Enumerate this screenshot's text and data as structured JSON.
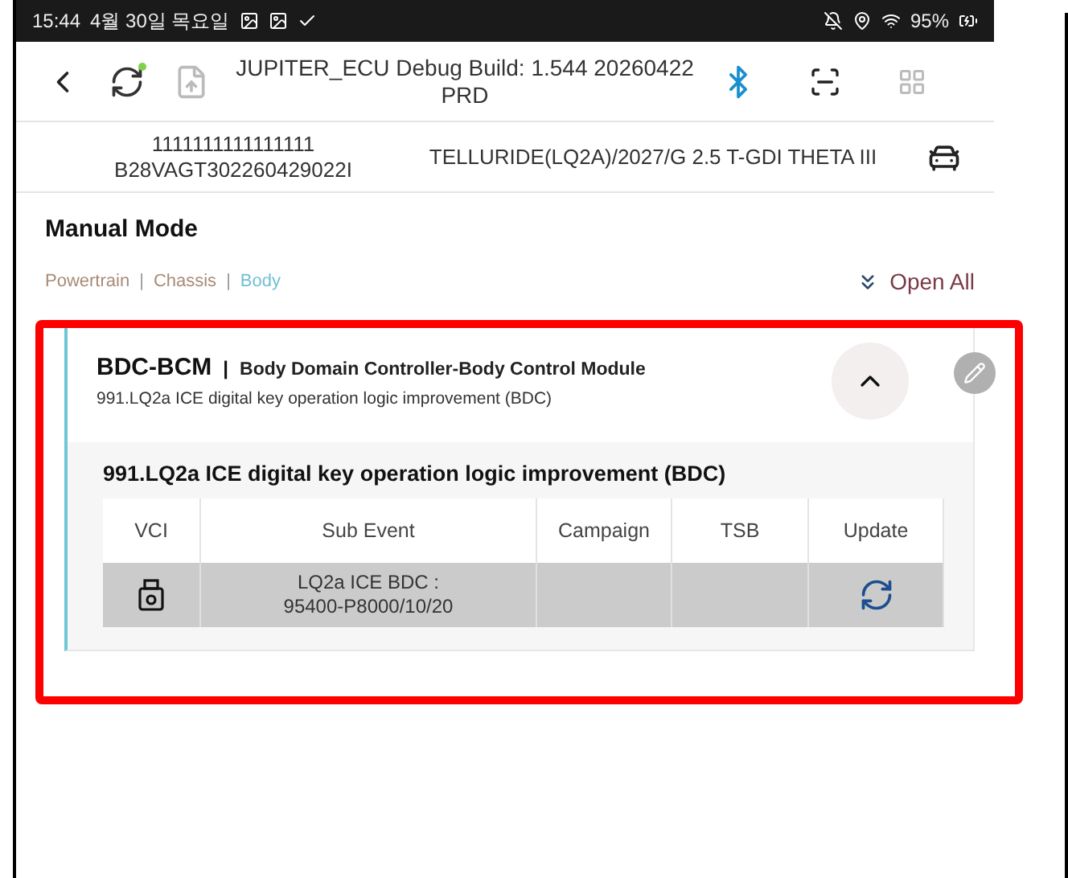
{
  "status_bar": {
    "time": "15:44",
    "date": "4월 30일 목요일",
    "battery": "95%"
  },
  "header": {
    "title": "JUPITER_ECU Debug Build: 1.544 20260422 PRD"
  },
  "vehicle": {
    "number": "1111111111111111",
    "vin": "B28VAGT302260429022I",
    "model": "TELLURIDE(LQ2A)/2027/G 2.5 T-GDI THETA III"
  },
  "section_title": "Manual Mode",
  "categories": [
    {
      "label": "Powertrain",
      "selected": false
    },
    {
      "label": "Chassis",
      "selected": false
    },
    {
      "label": "Body",
      "selected": true
    }
  ],
  "category_separator": "|",
  "open_all": "Open All",
  "module": {
    "code": "BDC-BCM",
    "separator": "|",
    "name": "Body Domain Controller-Body Control Module",
    "description": "991.LQ2a ICE digital key operation logic improvement (BDC)",
    "expanded": true,
    "event_title": "991.LQ2a ICE digital key operation logic improvement (BDC)",
    "columns": [
      "VCI",
      "Sub Event",
      "Campaign",
      "TSB",
      "Update"
    ],
    "rows": [
      {
        "sub_event": "LQ2a ICE BDC :\n95400-P8000/10/20",
        "campaign": "",
        "tsb": ""
      }
    ]
  }
}
